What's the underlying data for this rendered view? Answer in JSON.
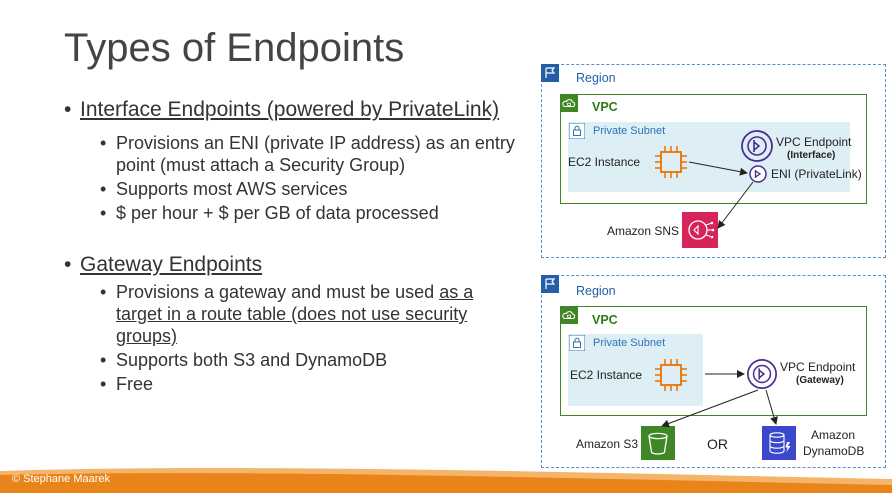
{
  "slide": {
    "title": "Types of Endpoints",
    "footer": "© Stephane Maarek"
  },
  "left": {
    "interface": {
      "heading": "Interface Endpoints (powered by PrivateLink)",
      "bullets": [
        "Provisions an ENI (private IP address) as an entry",
        "point (must attach a Security Group)",
        "Supports most AWS services",
        "$ per hour + $ per GB of data processed"
      ]
    },
    "gateway": {
      "heading": "Gateway Endpoints",
      "bullet1_prefix": "Provisions a gateway and must be used ",
      "bullet1_link_line1": "as a",
      "bullet1_link_line2": "target in a route table (does not use security",
      "bullet1_link_line3": "groups)",
      "bullets": [
        "Supports both S3 and DynamoDB",
        "Free"
      ]
    }
  },
  "diagram_top": {
    "region": "Region",
    "vpc": "VPC",
    "subnet": "Private Subnet",
    "ec2": "EC2 Instance",
    "endpoint": "VPC Endpoint",
    "endpoint_type": "(Interface)",
    "eni": "ENI (PrivateLink)",
    "service": "Amazon SNS"
  },
  "diagram_bottom": {
    "region": "Region",
    "vpc": "VPC",
    "subnet": "Private Subnet",
    "ec2": "EC2 Instance",
    "endpoint": "VPC Endpoint",
    "endpoint_type": "(Gateway)",
    "s3": "Amazon S3",
    "or": "OR",
    "dynamo_line1": "Amazon",
    "dynamo_line2": "DynamoDB"
  },
  "colors": {
    "region": "#5b8ec9",
    "vpc": "#3f8624",
    "subnet_bg": "#deeef5",
    "ec2": "#ed7100",
    "endpoint": "#4b2d8f",
    "sns": "#d6245a",
    "s3": "#3f8624",
    "dynamo": "#3b48cc",
    "footer": "#e8841a"
  }
}
